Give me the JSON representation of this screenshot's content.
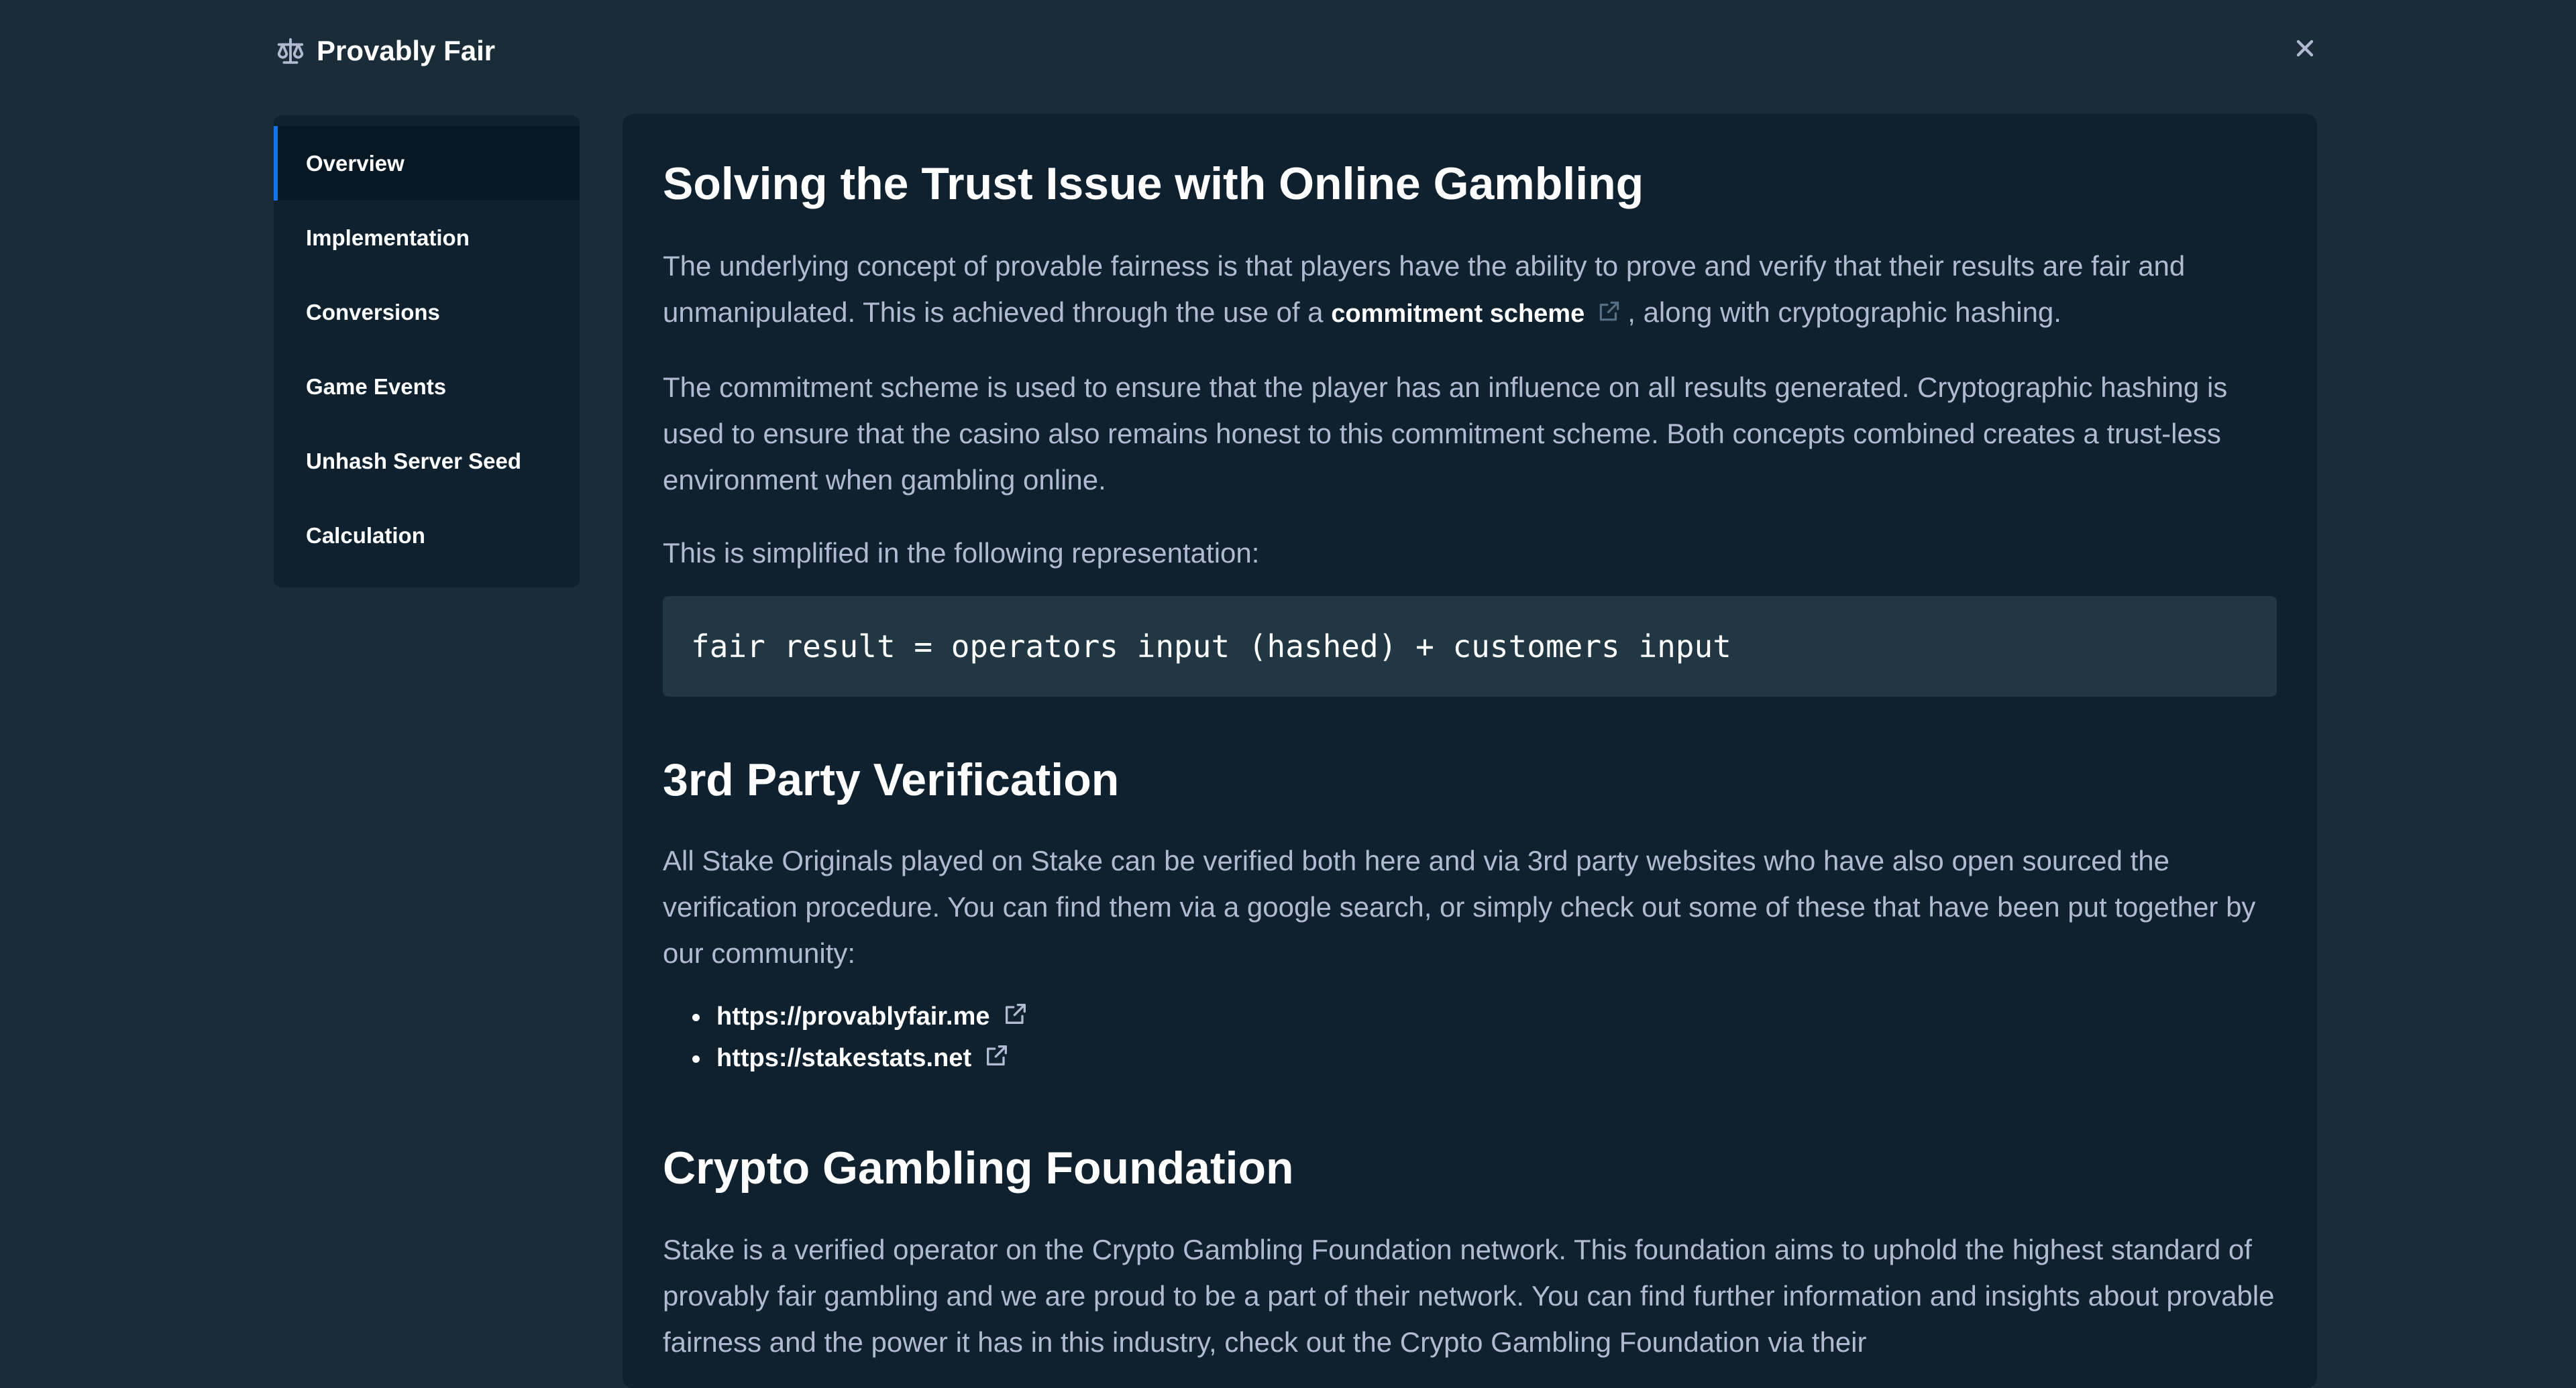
{
  "header": {
    "title": "Provably Fair",
    "icon": "scale-icon",
    "close_icon": "close-icon"
  },
  "sidebar": {
    "items": [
      {
        "label": "Overview",
        "active": true
      },
      {
        "label": "Implementation",
        "active": false
      },
      {
        "label": "Conversions",
        "active": false
      },
      {
        "label": "Game Events",
        "active": false
      },
      {
        "label": "Unhash Server Seed",
        "active": false
      },
      {
        "label": "Calculation",
        "active": false
      }
    ]
  },
  "content": {
    "section1": {
      "heading": "Solving the Trust Issue with Online Gambling",
      "p1_before": "The underlying concept of provable fairness is that players have the ability to prove and verify that their results are fair and unmanipulated. This is achieved through the use of a ",
      "p1_link": "commitment scheme",
      "p1_after": ", along with cryptographic hashing.",
      "p2": "The commitment scheme is used to ensure that the player has an influence on all results generated. Cryptographic hashing is used to ensure that the casino also remains honest to this commitment scheme. Both concepts combined creates a trust-less environment when gambling online.",
      "p3": "This is simplified in the following representation:",
      "code": "fair result = operators input (hashed) + customers input"
    },
    "section2": {
      "heading": "3rd Party Verification",
      "p1": "All Stake Originals played on Stake can be verified both here and via 3rd party websites who have also open sourced the verification procedure. You can find them via a google search, or simply check out some of these that have been put together by our community:",
      "links": [
        {
          "label": "https://provablyfair.me"
        },
        {
          "label": "https://stakestats.net"
        }
      ]
    },
    "section3": {
      "heading": "Crypto Gambling Foundation",
      "p1": "Stake is a verified operator on the Crypto Gambling Foundation network. This foundation aims to uphold the highest standard of provably fair gambling and we are proud to be a part of their network. You can find further information and insights about provable fairness and the power it has in this industry, check out the Crypto Gambling Foundation via their"
    }
  },
  "colors": {
    "page_bg": "#1a2c38",
    "panel_bg": "#0f212e",
    "active_nav_bg": "#071824",
    "accent": "#1475e1",
    "code_bg": "#213743",
    "body_text": "#b1bad3",
    "heading_text": "#ffffff"
  }
}
